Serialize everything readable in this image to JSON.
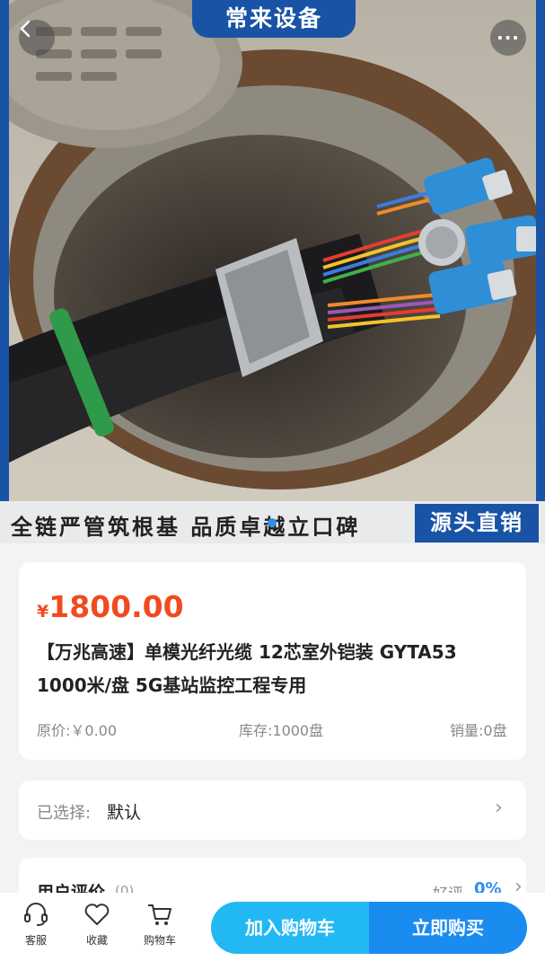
{
  "colors": {
    "brand_blue": "#1853a6",
    "price_red": "#f04a1f",
    "cart_blue": "#22b8f4",
    "buy_blue": "#1a8cf0",
    "good_blue": "#2b8ff0"
  },
  "hero": {
    "brand_text": "常来设备",
    "slogan": "全链严管筑根基 品质卓越立口碑",
    "source_tag": "源头直销",
    "back_icon": "chevron-left-icon",
    "more_icon": "more-icon",
    "more_label": "···"
  },
  "product": {
    "currency": "¥",
    "price": "1800.00",
    "title": "【万兆高速】单模光纤光缆 12芯室外铠装 GYTA53 1000米/盘 5G基站监控工程专用",
    "original_price": "原价:￥0.00",
    "stock": "库存:1000盘",
    "sales": "销量:0盘"
  },
  "selection": {
    "label": "已选择:",
    "value": "默认"
  },
  "reviews": {
    "title": "用户评价",
    "count": "(0)",
    "good_label": "好评",
    "good_value": "0%"
  },
  "bottom_bar": {
    "service": {
      "label": "客服",
      "icon": "headset-icon"
    },
    "favorite": {
      "label": "收藏",
      "icon": "heart-icon"
    },
    "cart": {
      "label": "购物车",
      "icon": "cart-icon"
    },
    "add_cart": "加入购物车",
    "buy_now": "立即购买"
  }
}
